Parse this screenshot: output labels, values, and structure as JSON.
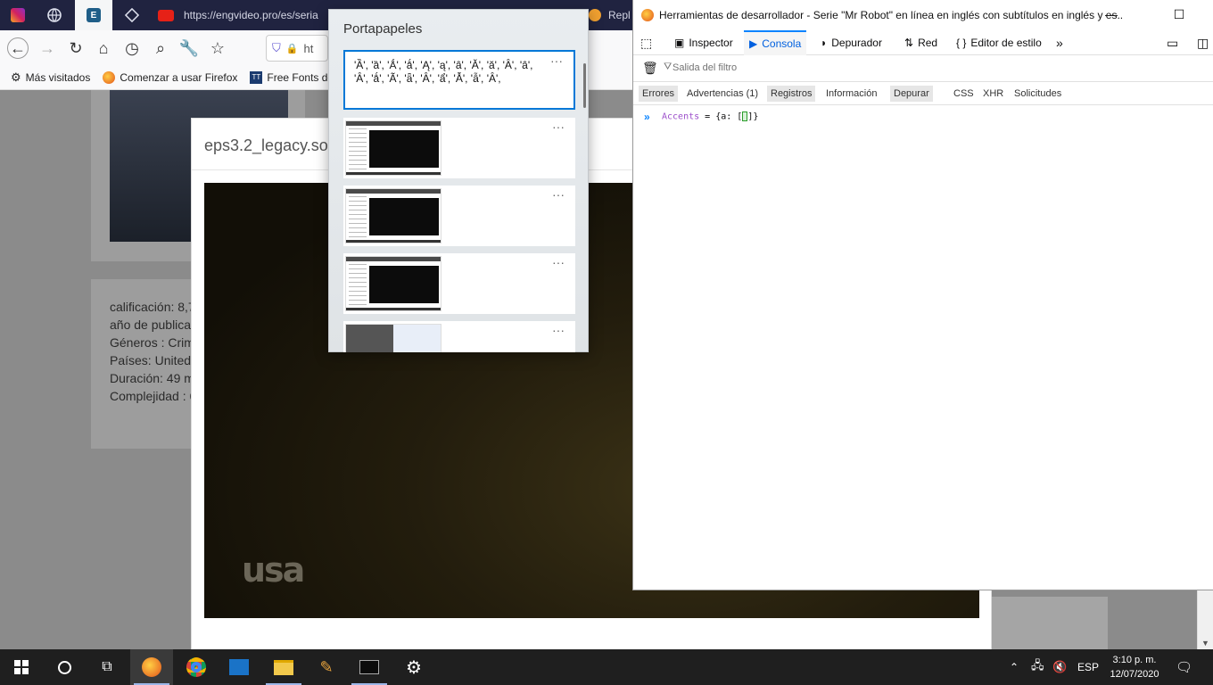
{
  "browser": {
    "url_text": "https://engvideo.pro/es/seria",
    "background_tab_label": "Repl",
    "urlbar_partial": "ht",
    "bookmarks": [
      {
        "label": "Más visitados"
      },
      {
        "label": "Comenzar a usar Firefox"
      },
      {
        "label": "Free Fonts dov"
      }
    ]
  },
  "page": {
    "player_title": "eps3.2_legacy.so",
    "video_logo": "usa",
    "info_lines": [
      "calificación: 8,7",
      "año de publica",
      "Géneros : Crim",
      "Países: United",
      "Duración: 49 m",
      "Complejidad : 6"
    ]
  },
  "clipboard": {
    "title": "Portapapeles",
    "first_item_text": "'Ȁ', 'ȁ', 'Ǻ', 'ǻ', 'Ą', 'ą', 'ȃ', 'Ă', 'ă', 'Ȃ', 'ȃ', 'Ȃ', 'ǻ', 'Ã', 'ǟ', 'Ȃ', 'ẩ', 'Ẫ', 'ẫ', 'Ȃ',",
    "more_glyph": "···"
  },
  "devtools": {
    "title": "Herramientas de desarrollador - Serie \"Mr Robot\" en línea en inglés con subtítulos en inglés y es...",
    "tabs": [
      {
        "label": "Inspector"
      },
      {
        "label": "Consola"
      },
      {
        "label": "Depurador"
      },
      {
        "label": "Red"
      },
      {
        "label": "Editor de estilo"
      }
    ],
    "filter_placeholder": "Salida del filtro",
    "categories": [
      {
        "label": "Errores"
      },
      {
        "label": "Advertencias (1)"
      },
      {
        "label": "Registros"
      },
      {
        "label": "Información"
      },
      {
        "label": "Depurar"
      },
      {
        "label": "CSS"
      },
      {
        "label": "XHR"
      },
      {
        "label": "Solicitudes"
      }
    ],
    "console_identifier": "Accents",
    "console_rest": " = {a: [",
    "console_end": "]}"
  },
  "taskbar": {
    "language": "ESP",
    "time": "3:10 p. m.",
    "date": "12/07/2020"
  }
}
